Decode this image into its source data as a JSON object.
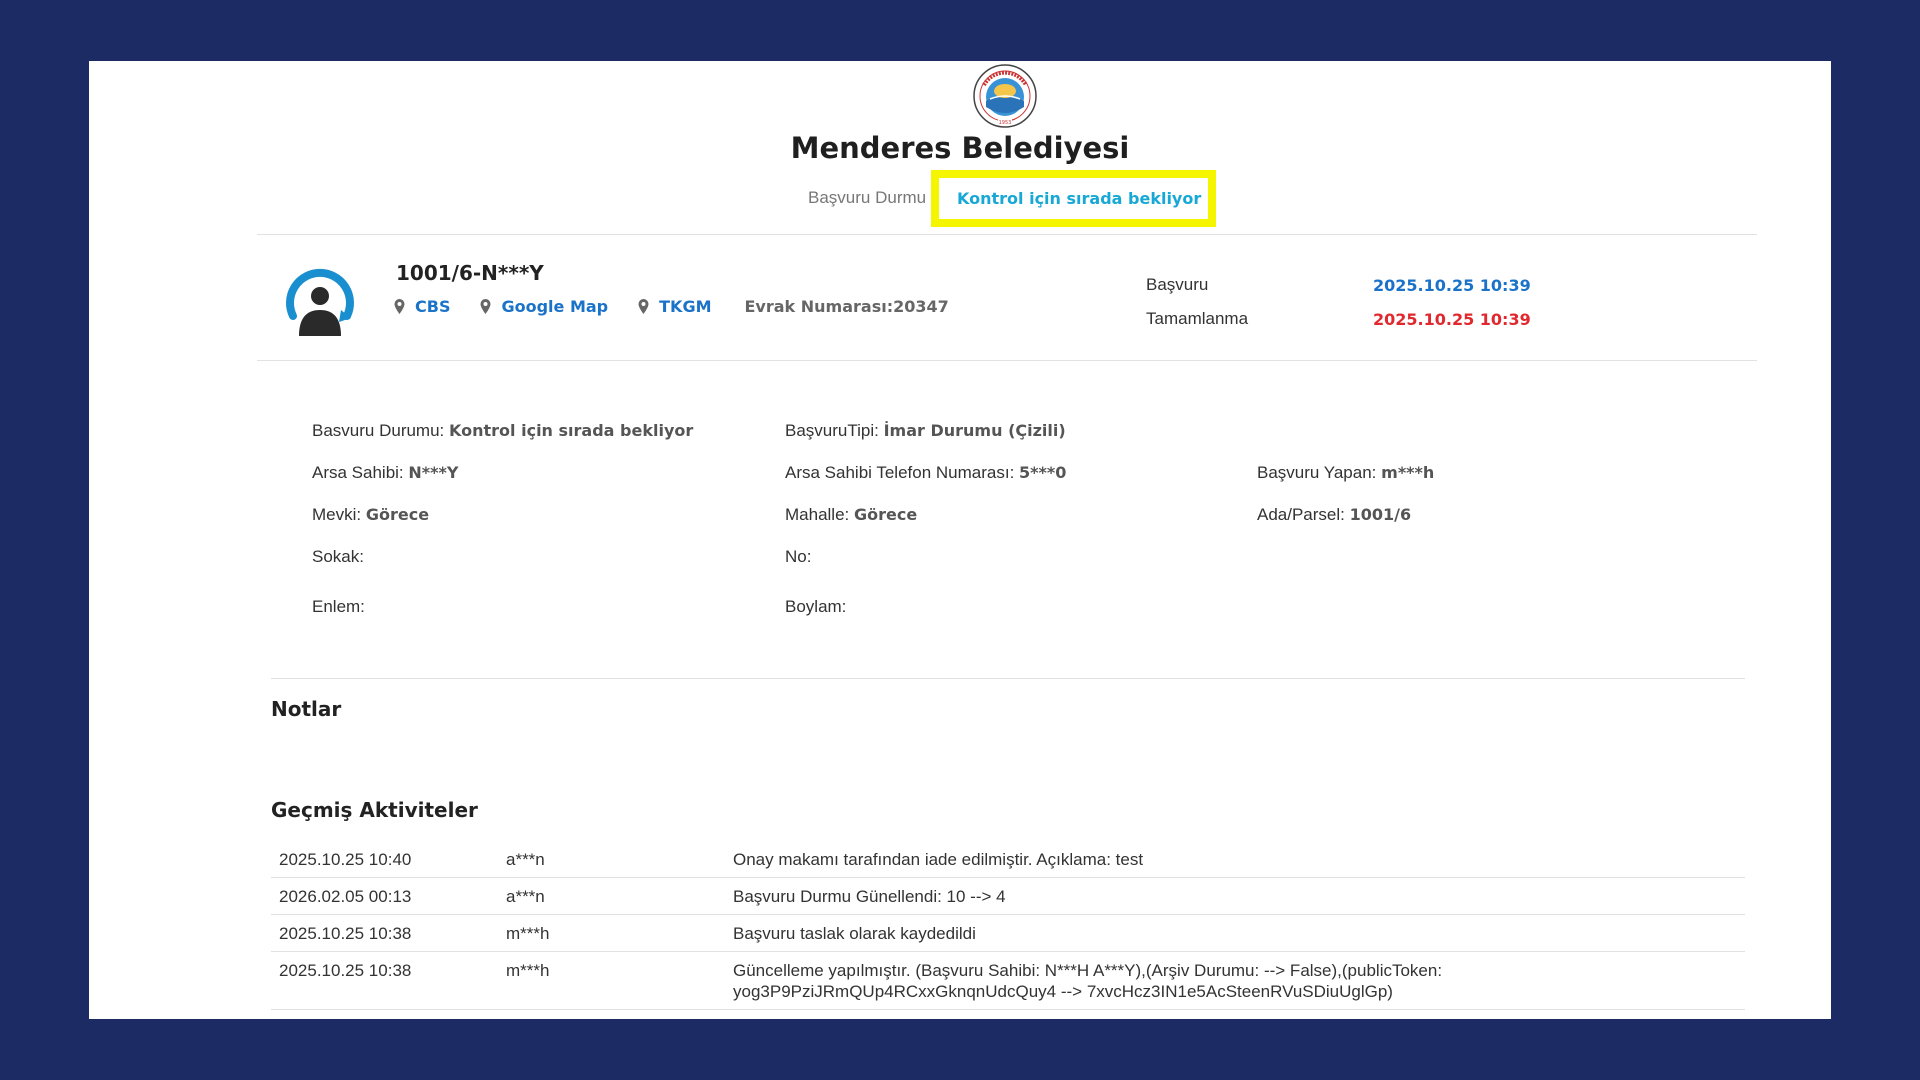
{
  "header": {
    "logo_text_top": "MENDERES BELEDİYESİ",
    "logo_year": "1953",
    "title": "Menderes Belediyesi",
    "status_label": "Başvuru Durmu",
    "status_value": "Kontrol için sırada bekliyor"
  },
  "application": {
    "number": "1001/6-N***Y",
    "links": [
      {
        "icon": "map-pin-icon",
        "label": "CBS"
      },
      {
        "icon": "map-pin-icon",
        "label": "Google Map"
      },
      {
        "icon": "map-pin-icon",
        "label": "TKGM"
      }
    ],
    "evrak": "Evrak Numarası:20347",
    "dates": [
      {
        "label": "Başvuru",
        "value": "2025.10.25 10:39",
        "color": "#1a73c9"
      },
      {
        "label": "Tamamlanma",
        "value": "2025.10.25 10:39",
        "color": "#e0282e"
      }
    ]
  },
  "details": {
    "basvuru_durumu": {
      "label": "Basvuru Durumu:",
      "value": "Kontrol için sırada bekliyor"
    },
    "basvuru_tipi": {
      "label": "BaşvuruTipi:",
      "value": "İmar Durumu (Çizili)"
    },
    "arsa_sahibi": {
      "label": "Arsa Sahibi:",
      "value": "N***Y"
    },
    "arsa_telefon": {
      "label": "Arsa Sahibi Telefon Numarası:",
      "value": "5***0"
    },
    "basvuru_yapan": {
      "label": "Başvuru Yapan:",
      "value": "m***h"
    },
    "mevki": {
      "label": "Mevki:",
      "value": "Görece"
    },
    "mahalle": {
      "label": "Mahalle:",
      "value": "Görece"
    },
    "ada_parsel": {
      "label": "Ada/Parsel:",
      "value": "1001/6"
    },
    "sokak": {
      "label": "Sokak:",
      "value": ""
    },
    "no": {
      "label": "No:",
      "value": ""
    },
    "enlem": {
      "label": "Enlem:",
      "value": ""
    },
    "boylam": {
      "label": "Boylam:",
      "value": ""
    }
  },
  "notes": {
    "title": "Notlar"
  },
  "activities": {
    "title": "Geçmiş Aktiviteler",
    "rows": [
      {
        "date": "2025.10.25 10:40",
        "user": "a***n",
        "text": "Onay makamı tarafından iade edilmiştir. Açıklama: test"
      },
      {
        "date": "2026.02.05 00:13",
        "user": "a***n",
        "text": "Başvuru Durmu Günellendi: 10 --> 4"
      },
      {
        "date": "2025.10.25 10:38",
        "user": "m***h",
        "text": "Başvuru taslak olarak kaydedildi"
      },
      {
        "date": "2025.10.25 10:38",
        "user": "m***h",
        "text": "Güncelleme yapılmıştır. (Başvuru Sahibi: N***H A***Y),(Arşiv Durumu: --> False),(publicToken: yog3P9PziJRmQUp4RCxxGknqnUdcQuy4 --> 7xvcHcz3IN1e5AcSteenRVuSDiuUglGp)"
      }
    ]
  }
}
